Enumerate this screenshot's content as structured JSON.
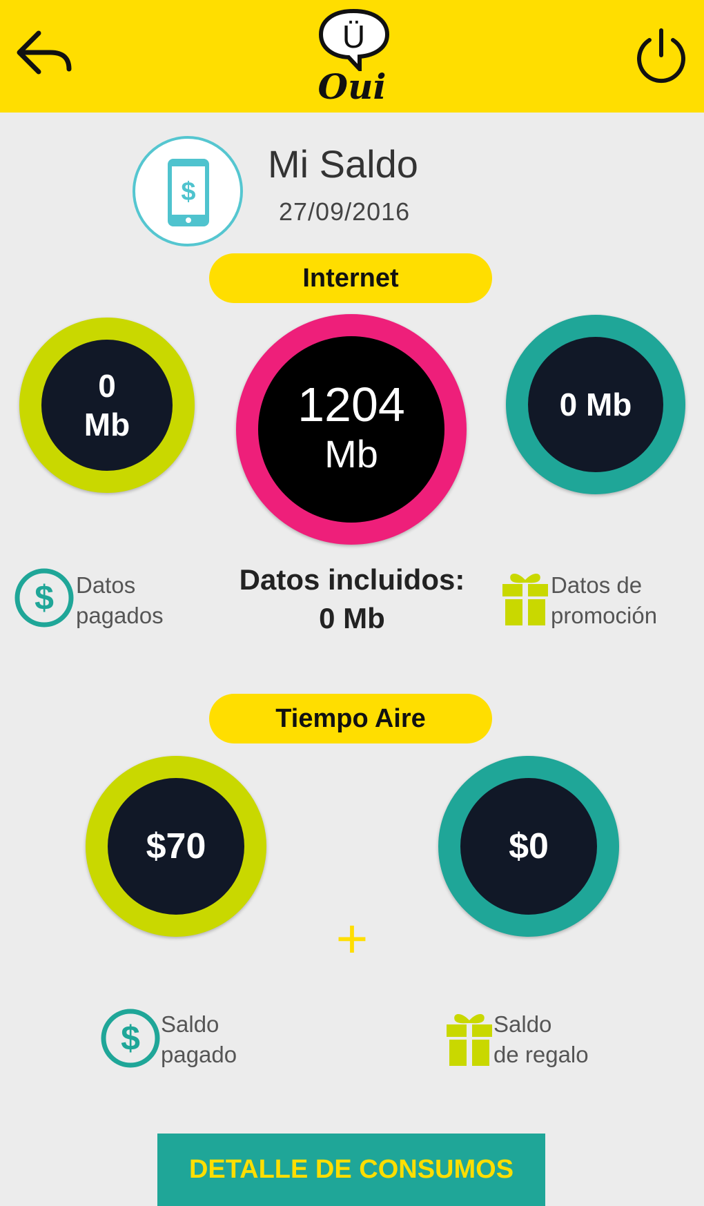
{
  "header": {
    "back_icon": "back-arrow-icon",
    "logo_mark": "Ü",
    "logo_text": "Oui",
    "power_icon": "power-icon"
  },
  "balance": {
    "icon": "phone-dollar-icon",
    "title": "Mi Saldo",
    "date": "27/09/2016"
  },
  "internet": {
    "section_label": "Internet",
    "paid": {
      "value": "0",
      "unit": "Mb",
      "label_line1": "Datos",
      "label_line2": "pagados",
      "icon": "dollar-circle-icon"
    },
    "included": {
      "value": "1204",
      "unit": "Mb",
      "label": "Datos incluidos:",
      "label_value": "0 Mb"
    },
    "promo": {
      "value": "0 Mb",
      "label_line1": "Datos de",
      "label_line2": "promoción",
      "icon": "gift-icon"
    }
  },
  "airtime": {
    "section_label": "Tiempo Aire",
    "paid": {
      "value": "$70",
      "label_line1": "Saldo",
      "label_line2": "pagado",
      "icon": "dollar-circle-icon"
    },
    "gift": {
      "value": "$0",
      "label_line1": "Saldo",
      "label_line2": "de regalo",
      "icon": "gift-icon"
    },
    "plus": "+"
  },
  "actions": {
    "detail_button": "DETALLE DE CONSUMOS"
  },
  "colors": {
    "brand_yellow": "#ffde00",
    "lime": "#c9d800",
    "pink": "#ee1f7a",
    "teal": "#1fa698",
    "dark": "#111827"
  }
}
